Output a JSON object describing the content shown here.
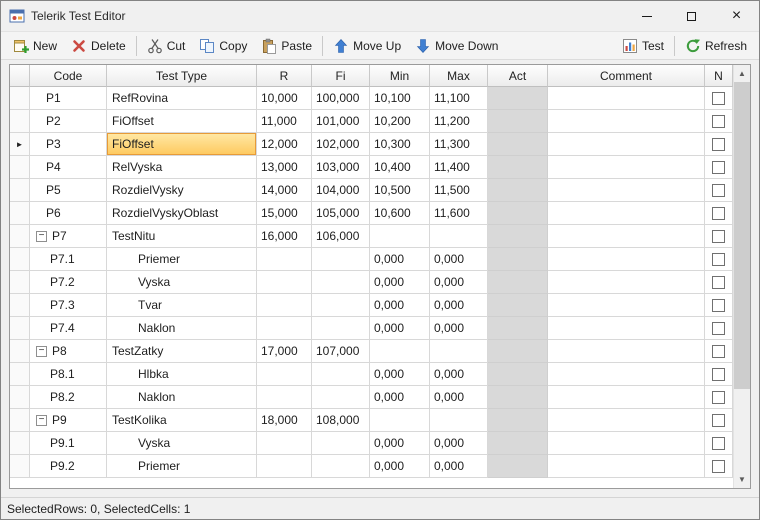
{
  "window": {
    "title": "Telerik Test Editor",
    "status_text": "SelectedRows: 0, SelectedCells: 1"
  },
  "icons": {
    "close": "×",
    "scroll_up": "▲",
    "scroll_down": "▼",
    "collapse": "−",
    "current_row_marker": "►"
  },
  "colors": {
    "current_cell_bg_top": "#FFE9A6",
    "current_cell_bg_bottom": "#FEC95E",
    "current_cell_border": "#E79B38",
    "act_column_bg": "#D9D9D9"
  },
  "toolbar": {
    "items": [
      {
        "label": "New",
        "icon": "new-form-icon"
      },
      {
        "label": "Delete",
        "icon": "delete-icon"
      },
      {
        "label": "Cut",
        "icon": "cut-icon"
      },
      {
        "label": "Copy",
        "icon": "copy-icon"
      },
      {
        "label": "Paste",
        "icon": "paste-icon"
      },
      {
        "label": "Move Up",
        "icon": "move-up-icon"
      },
      {
        "label": "Move Down",
        "icon": "move-down-icon"
      }
    ],
    "right_items": [
      {
        "label": "Test",
        "icon": "test-icon"
      },
      {
        "label": "Refresh",
        "icon": "refresh-icon"
      }
    ]
  },
  "grid": {
    "columns": [
      "Code",
      "Test Type",
      "R",
      "Fi",
      "Min",
      "Max",
      "Act",
      "Comment",
      "N"
    ],
    "rows": [
      {
        "code": "P1",
        "type": "RefRovina",
        "r": "10,000",
        "fi": "100,000",
        "min": "10,100",
        "max": "11,100",
        "act": "",
        "comment": "",
        "group": false,
        "child": false,
        "current": false,
        "n_checked": false
      },
      {
        "code": "P2",
        "type": "FiOffset",
        "r": "11,000",
        "fi": "101,000",
        "min": "10,200",
        "max": "11,200",
        "act": "",
        "comment": "",
        "group": false,
        "child": false,
        "current": false,
        "n_checked": false
      },
      {
        "code": "P3",
        "type": "FiOffset",
        "r": "12,000",
        "fi": "102,000",
        "min": "10,300",
        "max": "11,300",
        "act": "",
        "comment": "",
        "group": false,
        "child": false,
        "current": true,
        "n_checked": false
      },
      {
        "code": "P4",
        "type": "RelVyska",
        "r": "13,000",
        "fi": "103,000",
        "min": "10,400",
        "max": "11,400",
        "act": "",
        "comment": "",
        "group": false,
        "child": false,
        "current": false,
        "n_checked": false
      },
      {
        "code": "P5",
        "type": "RozdielVysky",
        "r": "14,000",
        "fi": "104,000",
        "min": "10,500",
        "max": "11,500",
        "act": "",
        "comment": "",
        "group": false,
        "child": false,
        "current": false,
        "n_checked": false
      },
      {
        "code": "P6",
        "type": "RozdielVyskyOblast",
        "r": "15,000",
        "fi": "105,000",
        "min": "10,600",
        "max": "11,600",
        "act": "",
        "comment": "",
        "group": false,
        "child": false,
        "current": false,
        "n_checked": false
      },
      {
        "code": "P7",
        "type": "TestNitu",
        "r": "16,000",
        "fi": "106,000",
        "min": "",
        "max": "",
        "act": "",
        "comment": "",
        "group": true,
        "child": false,
        "current": false,
        "n_checked": false
      },
      {
        "code": "P7.1",
        "type": "Priemer",
        "r": "",
        "fi": "",
        "min": "0,000",
        "max": "0,000",
        "act": "",
        "comment": "",
        "group": false,
        "child": true,
        "current": false,
        "n_checked": false
      },
      {
        "code": "P7.2",
        "type": "Vyska",
        "r": "",
        "fi": "",
        "min": "0,000",
        "max": "0,000",
        "act": "",
        "comment": "",
        "group": false,
        "child": true,
        "current": false,
        "n_checked": false
      },
      {
        "code": "P7.3",
        "type": "Tvar",
        "r": "",
        "fi": "",
        "min": "0,000",
        "max": "0,000",
        "act": "",
        "comment": "",
        "group": false,
        "child": true,
        "current": false,
        "n_checked": false
      },
      {
        "code": "P7.4",
        "type": "Naklon",
        "r": "",
        "fi": "",
        "min": "0,000",
        "max": "0,000",
        "act": "",
        "comment": "",
        "group": false,
        "child": true,
        "current": false,
        "n_checked": false
      },
      {
        "code": "P8",
        "type": "TestZatky",
        "r": "17,000",
        "fi": "107,000",
        "min": "",
        "max": "",
        "act": "",
        "comment": "",
        "group": true,
        "child": false,
        "current": false,
        "n_checked": false
      },
      {
        "code": "P8.1",
        "type": "Hlbka",
        "r": "",
        "fi": "",
        "min": "0,000",
        "max": "0,000",
        "act": "",
        "comment": "",
        "group": false,
        "child": true,
        "current": false,
        "n_checked": false
      },
      {
        "code": "P8.2",
        "type": "Naklon",
        "r": "",
        "fi": "",
        "min": "0,000",
        "max": "0,000",
        "act": "",
        "comment": "",
        "group": false,
        "child": true,
        "current": false,
        "n_checked": false
      },
      {
        "code": "P9",
        "type": "TestKolika",
        "r": "18,000",
        "fi": "108,000",
        "min": "",
        "max": "",
        "act": "",
        "comment": "",
        "group": true,
        "child": false,
        "current": false,
        "n_checked": false
      },
      {
        "code": "P9.1",
        "type": "Vyska",
        "r": "",
        "fi": "",
        "min": "0,000",
        "max": "0,000",
        "act": "",
        "comment": "",
        "group": false,
        "child": true,
        "current": false,
        "n_checked": false
      },
      {
        "code": "P9.2",
        "type": "Priemer",
        "r": "",
        "fi": "",
        "min": "0,000",
        "max": "0,000",
        "act": "",
        "comment": "",
        "group": false,
        "child": true,
        "current": false,
        "n_checked": false
      }
    ]
  }
}
